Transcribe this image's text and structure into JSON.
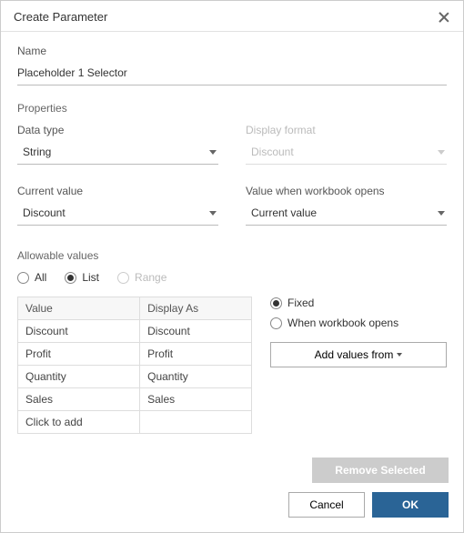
{
  "header": {
    "title": "Create Parameter"
  },
  "name": {
    "label": "Name",
    "value": "Placeholder 1 Selector"
  },
  "properties": {
    "label": "Properties"
  },
  "data_type": {
    "label": "Data type",
    "value": "String"
  },
  "display_format": {
    "label": "Display format",
    "value": "Discount"
  },
  "current_value": {
    "label": "Current value",
    "value": "Discount"
  },
  "value_open": {
    "label": "Value when workbook opens",
    "value": "Current value"
  },
  "allowable": {
    "label": "Allowable values",
    "options": {
      "all": "All",
      "list": "List",
      "range": "Range"
    }
  },
  "table": {
    "headers": {
      "value": "Value",
      "display_as": "Display As"
    },
    "rows": [
      {
        "value": "Discount",
        "display": "Discount"
      },
      {
        "value": "Profit",
        "display": "Profit"
      },
      {
        "value": "Quantity",
        "display": "Quantity"
      },
      {
        "value": "Sales",
        "display": "Sales"
      }
    ],
    "add_row": "Click to add"
  },
  "fixed_group": {
    "fixed": "Fixed",
    "when_open": "When workbook opens"
  },
  "add_values": "Add values from",
  "buttons": {
    "remove": "Remove Selected",
    "cancel": "Cancel",
    "ok": "OK"
  }
}
